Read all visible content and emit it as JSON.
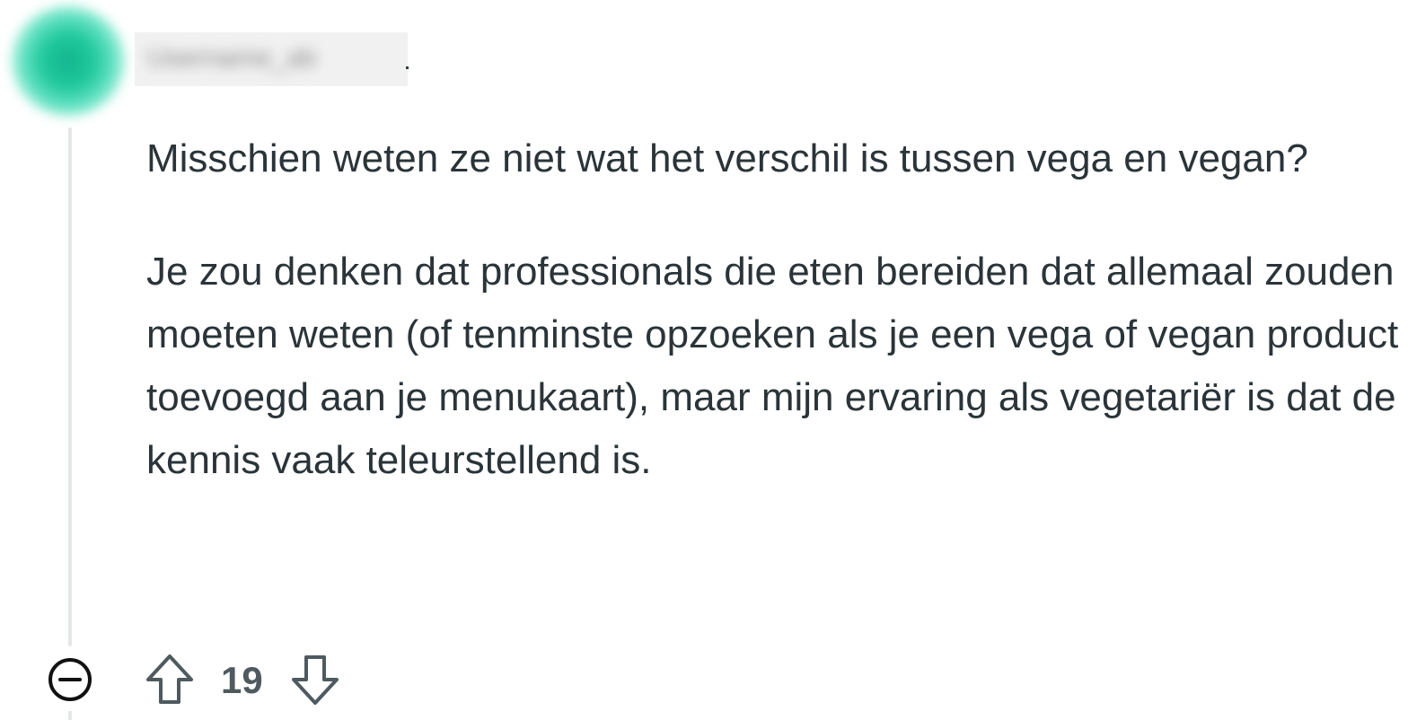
{
  "comment": {
    "author": "Username_ab",
    "paragraphs": [
      "Misschien weten ze niet wat het verschil is tussen vega en vegan?",
      "Je zou denken dat professionals die eten bereiden dat allemaal zouden moeten weten (of tenminste opzoeken als je een vega of vegan product toevoegd aan je menukaart), maar mijn ervaring als vegetariër is dat de kennis vaak teleurstellend is."
    ],
    "score": "19"
  },
  "icons": {
    "avatar": "avatar",
    "collapse": "collapse-minus-circle-icon",
    "upvote": "upvote-arrow-icon",
    "downvote": "downvote-arrow-icon"
  },
  "colors": {
    "avatar": "#1dc79b",
    "text": "#2a3439",
    "thread_line": "#e4e6e8"
  }
}
